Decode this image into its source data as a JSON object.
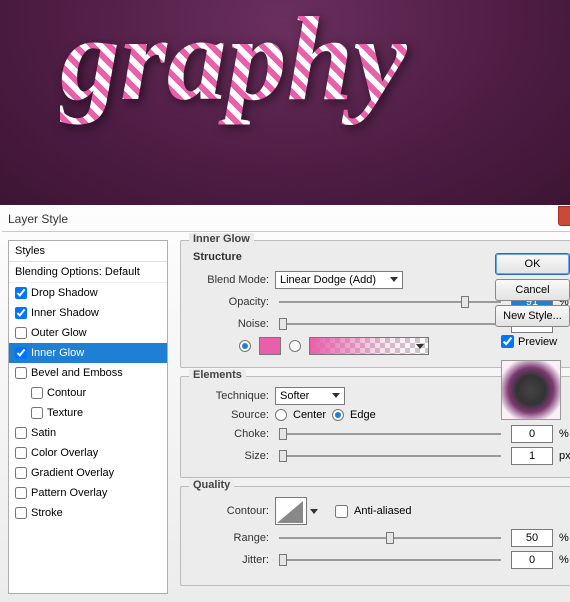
{
  "canvas_text": "graphy",
  "dialog": {
    "title": "Layer Style",
    "close_icon": "×"
  },
  "styles_panel": {
    "header": "Styles",
    "blending": "Blending Options: Default",
    "items": [
      {
        "label": "Drop Shadow",
        "checked": true,
        "active": false
      },
      {
        "label": "Inner Shadow",
        "checked": true,
        "active": false
      },
      {
        "label": "Outer Glow",
        "checked": false,
        "active": false
      },
      {
        "label": "Inner Glow",
        "checked": true,
        "active": true
      },
      {
        "label": "Bevel and Emboss",
        "checked": false,
        "active": false
      },
      {
        "label": "Contour",
        "checked": false,
        "active": false,
        "indent": true
      },
      {
        "label": "Texture",
        "checked": false,
        "active": false,
        "indent": true
      },
      {
        "label": "Satin",
        "checked": false,
        "active": false
      },
      {
        "label": "Color Overlay",
        "checked": false,
        "active": false
      },
      {
        "label": "Gradient Overlay",
        "checked": false,
        "active": false
      },
      {
        "label": "Pattern Overlay",
        "checked": false,
        "active": false
      },
      {
        "label": "Stroke",
        "checked": false,
        "active": false
      }
    ]
  },
  "main": {
    "title": "Inner Glow",
    "structure": {
      "title": "Structure",
      "blend_mode_label": "Blend Mode:",
      "blend_mode_value": "Linear Dodge (Add)",
      "opacity_label": "Opacity:",
      "opacity_value": "91",
      "opacity_unit": "%",
      "noise_label": "Noise:",
      "noise_value": "0",
      "noise_unit": "%",
      "solid_color": "#e85faa"
    },
    "elements": {
      "title": "Elements",
      "technique_label": "Technique:",
      "technique_value": "Softer",
      "source_label": "Source:",
      "source_center": "Center",
      "source_edge": "Edge",
      "choke_label": "Choke:",
      "choke_value": "0",
      "choke_unit": "%",
      "size_label": "Size:",
      "size_value": "1",
      "size_unit": "px"
    },
    "quality": {
      "title": "Quality",
      "contour_label": "Contour:",
      "anti_alias_label": "Anti-aliased",
      "range_label": "Range:",
      "range_value": "50",
      "range_unit": "%",
      "jitter_label": "Jitter:",
      "jitter_value": "0",
      "jitter_unit": "%"
    }
  },
  "right": {
    "ok": "OK",
    "cancel": "Cancel",
    "new_style": "New Style...",
    "preview": "Preview"
  }
}
